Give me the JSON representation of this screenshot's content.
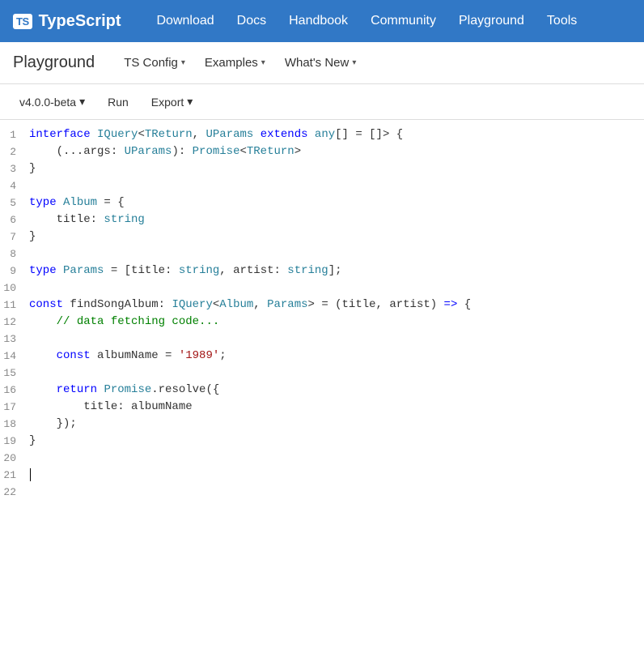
{
  "topNav": {
    "logo": {
      "badge": "TS",
      "title": "TypeScript"
    },
    "links": [
      {
        "label": "Download",
        "name": "download-link"
      },
      {
        "label": "Docs",
        "name": "docs-link"
      },
      {
        "label": "Handbook",
        "name": "handbook-link"
      },
      {
        "label": "Community",
        "name": "community-link"
      },
      {
        "label": "Playground",
        "name": "playground-link"
      },
      {
        "label": "Tools",
        "name": "tools-link"
      }
    ]
  },
  "subNav": {
    "title": "Playground",
    "buttons": [
      {
        "label": "TS Config",
        "name": "ts-config-btn",
        "hasChevron": true
      },
      {
        "label": "Examples",
        "name": "examples-btn",
        "hasChevron": true
      },
      {
        "label": "What's New",
        "name": "whats-new-btn",
        "hasChevron": true
      }
    ]
  },
  "toolbar": {
    "version": "v4.0.0-beta",
    "versionChevron": "▾",
    "run": "Run",
    "export": "Export",
    "exportChevron": "▾"
  },
  "code": {
    "lines": [
      {
        "num": 1,
        "raw": "interface IQuery<TReturn, UParams extends any[] = []> {"
      },
      {
        "num": 2,
        "raw": "    (...args: UParams): Promise<TReturn>"
      },
      {
        "num": 3,
        "raw": "}"
      },
      {
        "num": 4,
        "raw": ""
      },
      {
        "num": 5,
        "raw": "type Album = {"
      },
      {
        "num": 6,
        "raw": "    title: string"
      },
      {
        "num": 7,
        "raw": "}"
      },
      {
        "num": 8,
        "raw": ""
      },
      {
        "num": 9,
        "raw": "type Params = [title: string, artist: string];"
      },
      {
        "num": 10,
        "raw": ""
      },
      {
        "num": 11,
        "raw": "const findSongAlbum: IQuery<Album, Params> = (title, artist) => {"
      },
      {
        "num": 12,
        "raw": "    // data fetching code..."
      },
      {
        "num": 13,
        "raw": ""
      },
      {
        "num": 14,
        "raw": "    const albumName = '1989';"
      },
      {
        "num": 15,
        "raw": ""
      },
      {
        "num": 16,
        "raw": "    return Promise.resolve({"
      },
      {
        "num": 17,
        "raw": "        title: albumName"
      },
      {
        "num": 18,
        "raw": "    });"
      },
      {
        "num": 19,
        "raw": "}"
      },
      {
        "num": 20,
        "raw": ""
      },
      {
        "num": 21,
        "raw": "",
        "cursor": true
      },
      {
        "num": 22,
        "raw": ""
      }
    ]
  }
}
